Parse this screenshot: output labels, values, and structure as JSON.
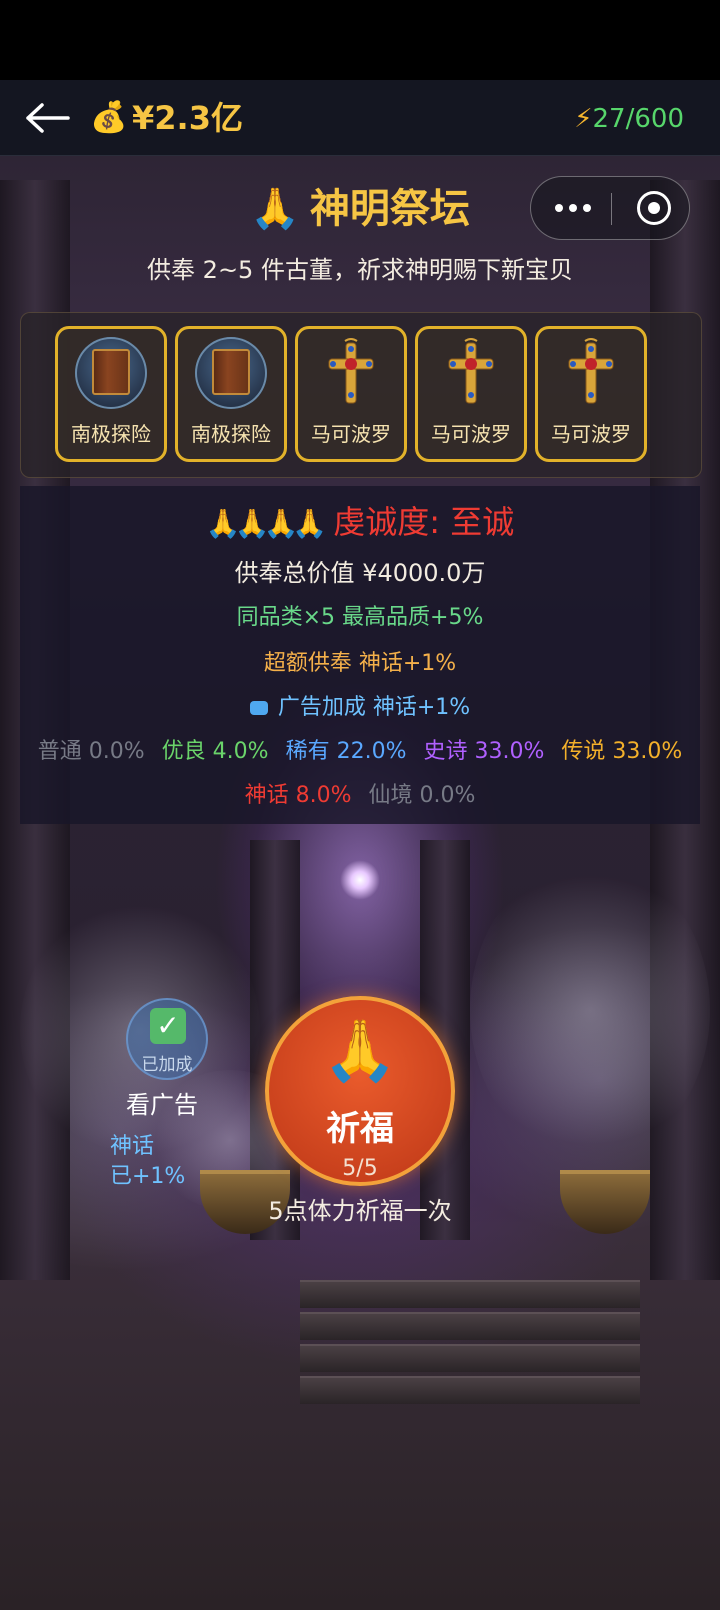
{
  "header": {
    "money_icon": "💰",
    "money": "¥2.3亿",
    "energy_icon": "⚡",
    "energy": "27/600"
  },
  "title": {
    "icon": "🙏",
    "text": "神明祭坛",
    "subtitle": "供奉 2~5 件古董，祈求神明赐下新宝贝"
  },
  "offerings": [
    {
      "name": "南极探险",
      "icon": "antarctic-book-icon"
    },
    {
      "name": "南极探险",
      "icon": "antarctic-book-icon"
    },
    {
      "name": "马可波罗",
      "icon": "gold-cross-icon"
    },
    {
      "name": "马可波罗",
      "icon": "gold-cross-icon"
    },
    {
      "name": "马可波罗",
      "icon": "gold-cross-icon"
    }
  ],
  "stats": {
    "piety_icons": "🙏🙏🙏🙏",
    "piety": "虔诚度: 至诚",
    "total_value": "供奉总价值 ¥4000.0万",
    "same_category": "同品类×5 最高品质+5%",
    "over_offering": "超额供奉 神话+1%",
    "ad_bonus": "广告加成 神话+1%",
    "rates": [
      {
        "name": "普通",
        "value": "0.0%",
        "color": "#777a86"
      },
      {
        "name": "优良",
        "value": "4.0%",
        "color": "#6ad46a"
      },
      {
        "name": "稀有",
        "value": "22.0%",
        "color": "#5aa8ff"
      },
      {
        "name": "史诗",
        "value": "33.0%",
        "color": "#b060ff"
      },
      {
        "name": "传说",
        "value": "33.0%",
        "color": "#f3b02a"
      },
      {
        "name": "神话",
        "value": "8.0%",
        "color": "#ef3b33"
      },
      {
        "name": "仙境",
        "value": "0.0%",
        "color": "#777a86"
      }
    ]
  },
  "ad": {
    "done_label": "已加成",
    "watch_label": "看广告",
    "bonus_line1": "神话",
    "bonus_line2": "已+1%"
  },
  "pray": {
    "icon": "🙏",
    "label": "祈福",
    "count": "5/5",
    "cost": "5点体力祈福一次"
  }
}
